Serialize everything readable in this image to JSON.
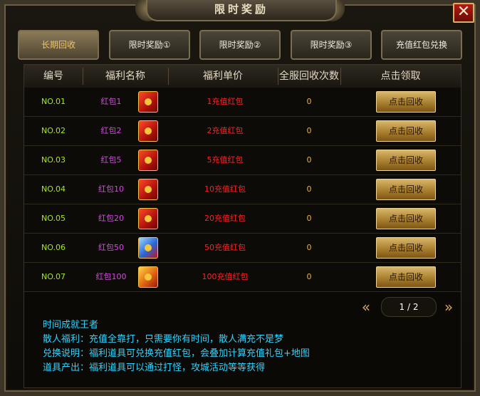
{
  "window": {
    "title": "限时奖励",
    "close_label": "✕"
  },
  "tabs": [
    {
      "label": "长期回收",
      "active": true
    },
    {
      "label": "限时奖励①",
      "active": false
    },
    {
      "label": "限时奖励②",
      "active": false
    },
    {
      "label": "限时奖励③",
      "active": false
    },
    {
      "label": "充值红包兑换",
      "active": false
    }
  ],
  "table": {
    "headers": [
      "编号",
      "福利名称",
      "福利单价",
      "全服回收次数",
      "点击领取"
    ],
    "rows": [
      {
        "no": "NO.01",
        "name": "红包1",
        "unit": "1充值红包",
        "count": "0",
        "button": "点击回收",
        "icon": "red-envelope-icon"
      },
      {
        "no": "NO.02",
        "name": "红包2",
        "unit": "2充值红包",
        "count": "0",
        "button": "点击回收",
        "icon": "red-envelope-icon"
      },
      {
        "no": "NO.03",
        "name": "红包5",
        "unit": "5充值红包",
        "count": "0",
        "button": "点击回收",
        "icon": "red-envelope-icon"
      },
      {
        "no": "NO.04",
        "name": "红包10",
        "unit": "10充值红包",
        "count": "0",
        "button": "点击回收",
        "icon": "red-envelope-icon"
      },
      {
        "no": "NO.05",
        "name": "红包20",
        "unit": "20充值红包",
        "count": "0",
        "button": "点击回收",
        "icon": "red-envelope-icon"
      },
      {
        "no": "NO.06",
        "name": "红包50",
        "unit": "50充值红包",
        "count": "0",
        "button": "点击回收",
        "icon": "blue-red-envelope-icon"
      },
      {
        "no": "NO.07",
        "name": "红包100",
        "unit": "100充值红包",
        "count": "0",
        "button": "点击回收",
        "icon": "gold-red-envelope-icon"
      }
    ]
  },
  "pager": {
    "text": "1 / 2",
    "prev_icon": "double-left-arrow-icon",
    "next_icon": "double-right-arrow-icon"
  },
  "notes": [
    "时间成就王者",
    "散人福利：充值全靠打，只需要你有时间，散人满充不是梦",
    "兑换说明：福利道具可兑换充值红包，会叠加计算充值礼包+地图",
    "道具产出：福利道具可以通过打怪，攻城活动等等获得"
  ],
  "colors": {
    "accent_gold": "#f0c36c",
    "number_green": "#a6e81e",
    "name_purple": "#d24be0",
    "price_red": "#ff2222",
    "count_orange": "#e8b432",
    "notes_cyan": "#2fd3ff"
  }
}
